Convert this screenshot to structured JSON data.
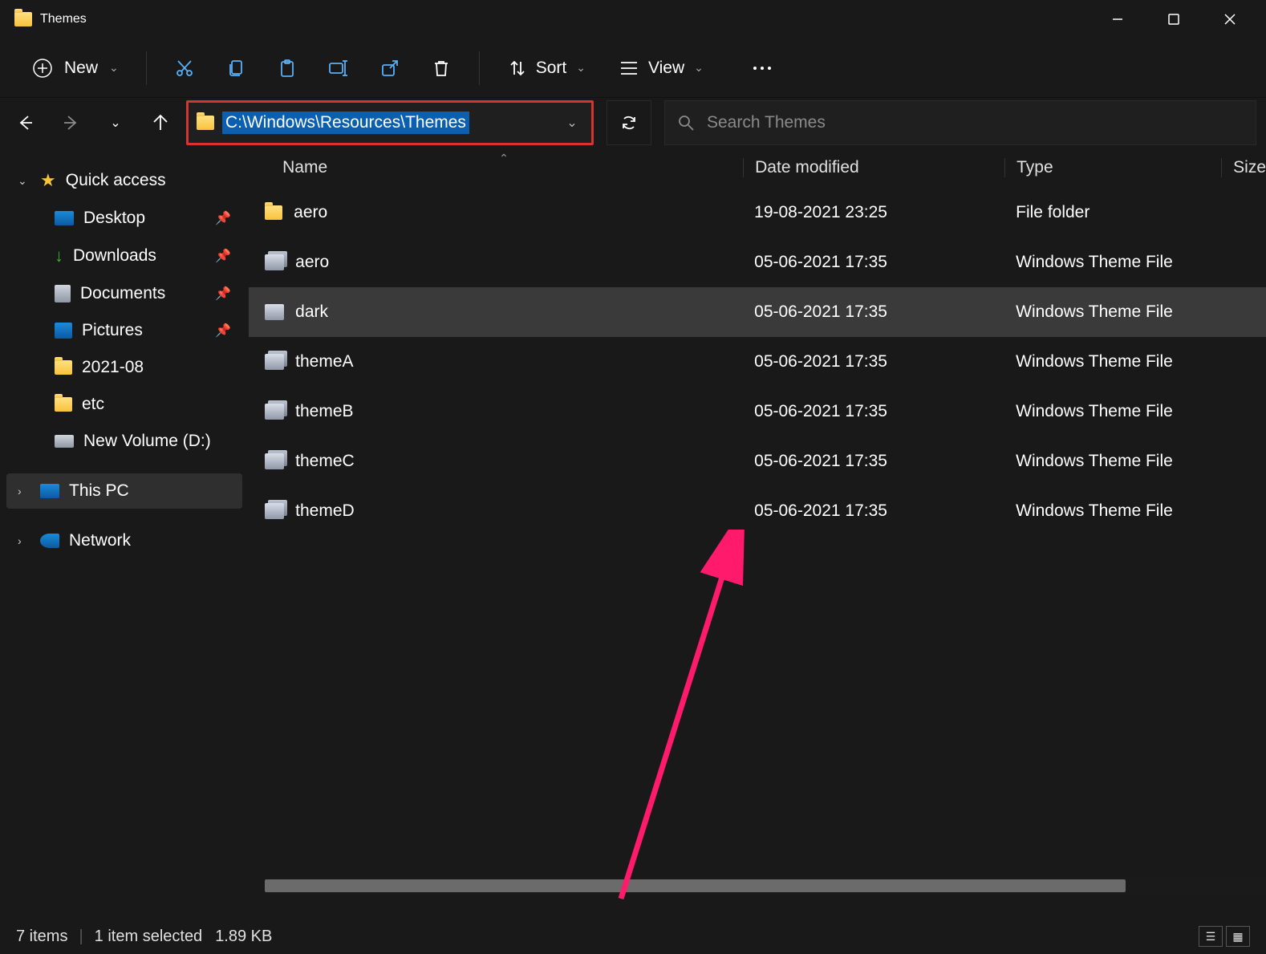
{
  "window": {
    "title": "Themes"
  },
  "toolbar": {
    "new_label": "New",
    "sort_label": "Sort",
    "view_label": "View"
  },
  "address": {
    "path": "C:\\Windows\\Resources\\Themes"
  },
  "search": {
    "placeholder": "Search Themes"
  },
  "sidebar": {
    "quick_access": "Quick access",
    "desktop": "Desktop",
    "downloads": "Downloads",
    "documents": "Documents",
    "pictures": "Pictures",
    "folder1": "2021-08",
    "folder2": "etc",
    "drive": "New Volume (D:)",
    "this_pc": "This PC",
    "network": "Network"
  },
  "columns": {
    "name": "Name",
    "date": "Date modified",
    "type": "Type",
    "size": "Size"
  },
  "rows": [
    {
      "name": "aero",
      "date": "19-08-2021 23:25",
      "type": "File folder",
      "kind": "folder"
    },
    {
      "name": "aero",
      "date": "05-06-2021 17:35",
      "type": "Windows Theme File",
      "kind": "theme"
    },
    {
      "name": "dark",
      "date": "05-06-2021 17:35",
      "type": "Windows Theme File",
      "kind": "theme",
      "selected": true
    },
    {
      "name": "themeA",
      "date": "05-06-2021 17:35",
      "type": "Windows Theme File",
      "kind": "theme"
    },
    {
      "name": "themeB",
      "date": "05-06-2021 17:35",
      "type": "Windows Theme File",
      "kind": "theme"
    },
    {
      "name": "themeC",
      "date": "05-06-2021 17:35",
      "type": "Windows Theme File",
      "kind": "theme"
    },
    {
      "name": "themeD",
      "date": "05-06-2021 17:35",
      "type": "Windows Theme File",
      "kind": "theme"
    }
  ],
  "status": {
    "items": "7 items",
    "selected": "1 item selected",
    "size": "1.89 KB"
  }
}
